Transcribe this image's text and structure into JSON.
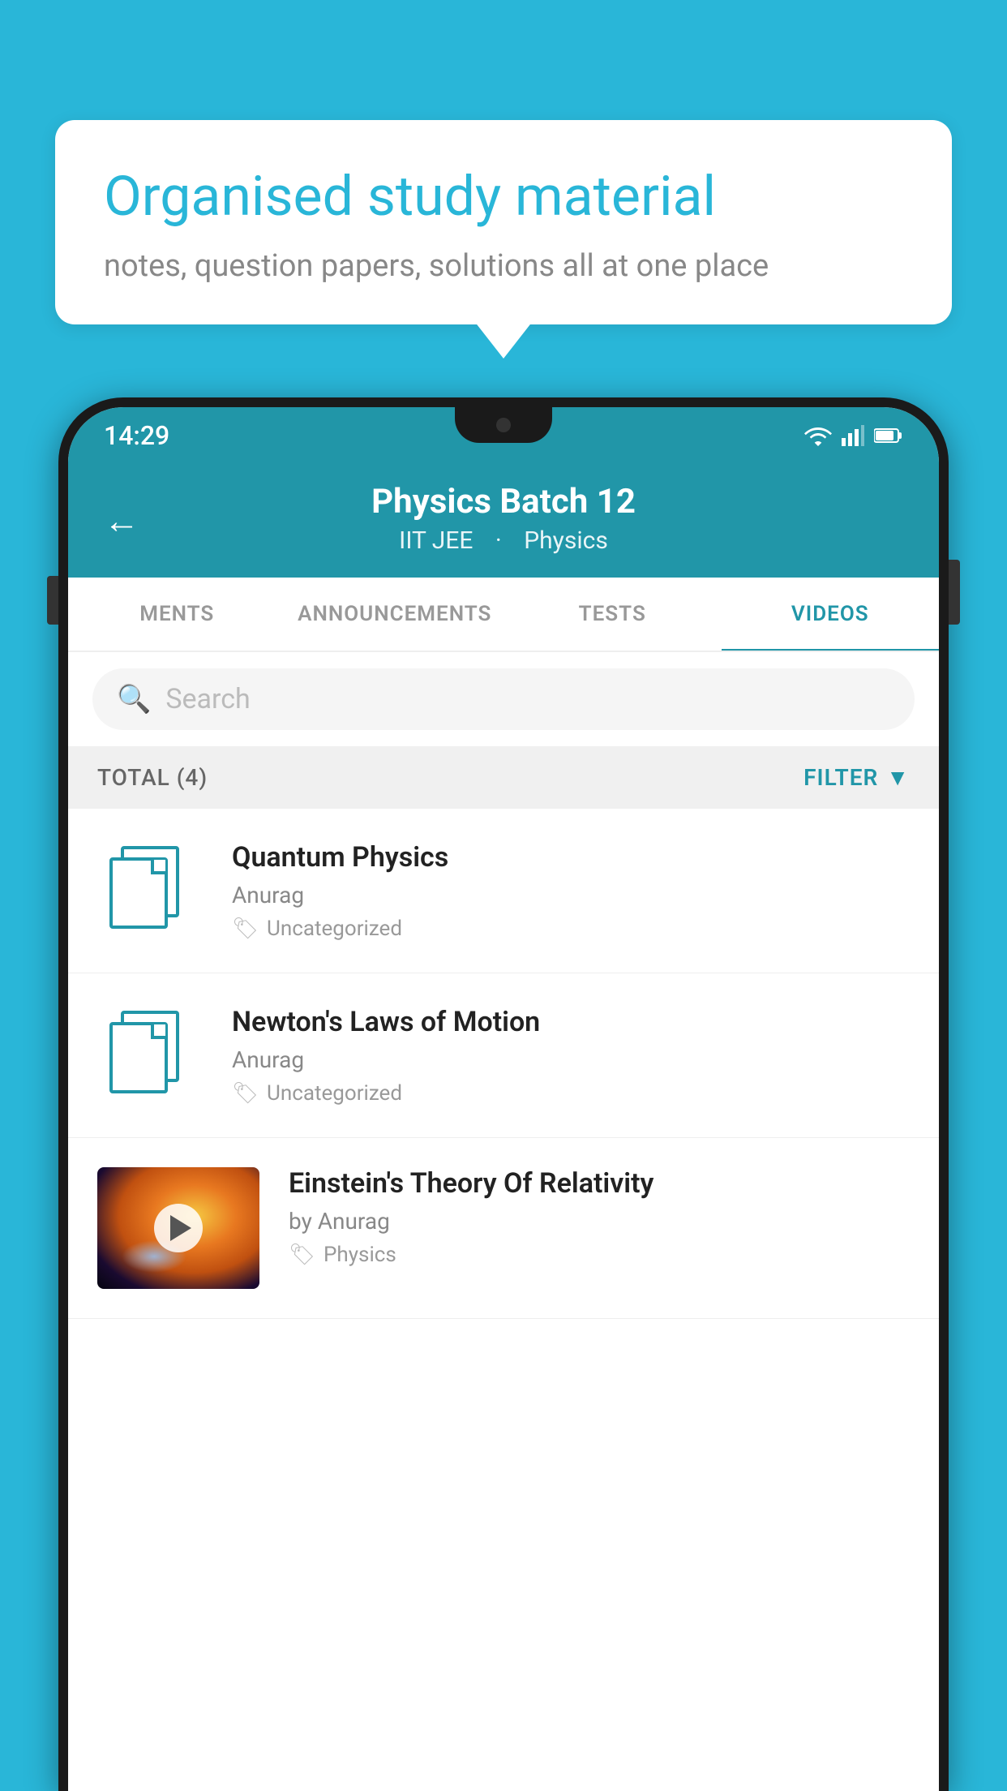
{
  "bubble": {
    "title": "Organised study material",
    "subtitle": "notes, question papers, solutions all at one place"
  },
  "statusBar": {
    "time": "14:29"
  },
  "header": {
    "title": "Physics Batch 12",
    "subtitle1": "IIT JEE",
    "subtitle2": "Physics"
  },
  "tabs": [
    {
      "label": "MENTS",
      "active": false
    },
    {
      "label": "ANNOUNCEMENTS",
      "active": false
    },
    {
      "label": "TESTS",
      "active": false
    },
    {
      "label": "VIDEOS",
      "active": true
    }
  ],
  "search": {
    "placeholder": "Search"
  },
  "filterBar": {
    "total": "TOTAL (4)",
    "filter": "FILTER"
  },
  "videos": [
    {
      "id": 1,
      "title": "Quantum Physics",
      "author": "Anurag",
      "tag": "Uncategorized",
      "hasThumb": false
    },
    {
      "id": 2,
      "title": "Newton's Laws of Motion",
      "author": "Anurag",
      "tag": "Uncategorized",
      "hasThumb": false
    },
    {
      "id": 3,
      "title": "Einstein's Theory Of Relativity",
      "author": "by Anurag",
      "tag": "Physics",
      "hasThumb": true
    }
  ]
}
